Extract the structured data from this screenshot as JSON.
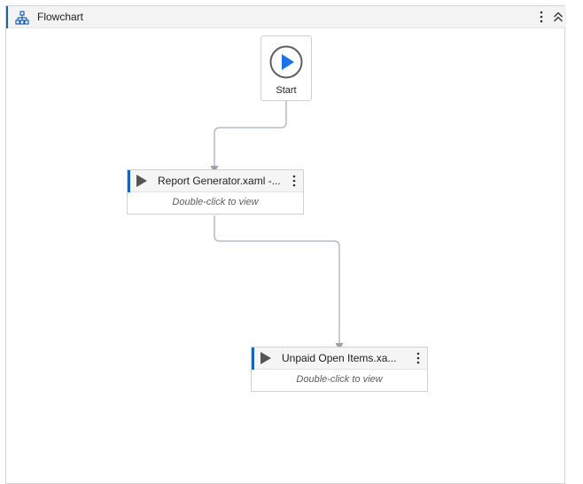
{
  "panel": {
    "title": "Flowchart"
  },
  "start": {
    "label": "Start"
  },
  "activities": [
    {
      "title": "Report Generator.xaml -...",
      "hint": "Double-click to view"
    },
    {
      "title": "Unpaid Open Items.xa...",
      "hint": "Double-click to view"
    }
  ],
  "colors": {
    "accent": "#1a63b8",
    "wire": "#b4bcc8",
    "start_button": "#1a73e8"
  }
}
